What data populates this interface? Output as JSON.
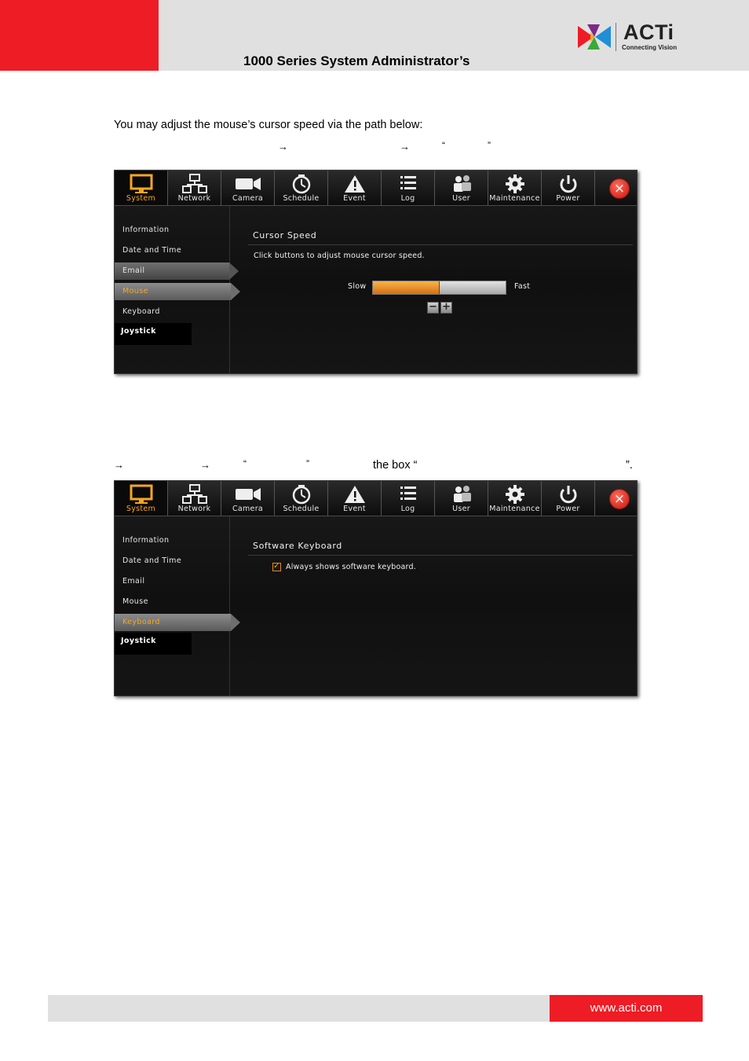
{
  "header": {
    "title": "1000 Series System Administrator’s",
    "brand": "ACTi",
    "tagline": "Connecting Vision",
    "red": "#ee1c25"
  },
  "body_text": {
    "intro": "You may adjust the mouse’s cursor speed via the path below:",
    "path_line1_quotes": [
      "“",
      "”"
    ],
    "path_line2_box": "the box “",
    "path_line2_end": "”."
  },
  "ui": {
    "nav": [
      "System",
      "Network",
      "Camera",
      "Schedule",
      "Event",
      "Log",
      "User",
      "Maintenance",
      "Power"
    ],
    "sidebar": [
      "Information",
      "Date and Time",
      "Email",
      "Mouse",
      "Keyboard",
      "Joystick"
    ],
    "accent": "#f5a623"
  },
  "screenshot1": {
    "section_title": "Cursor Speed",
    "description": "Click buttons to adjust mouse cursor speed.",
    "slow_label": "Slow",
    "fast_label": "Fast",
    "speed_level": 0.5,
    "minus": "−",
    "plus": "+"
  },
  "screenshot2": {
    "section_title": "Software Keyboard",
    "option_label": "Always shows software keyboard.",
    "checked": true
  },
  "footer": {
    "url": "www.acti.com"
  }
}
